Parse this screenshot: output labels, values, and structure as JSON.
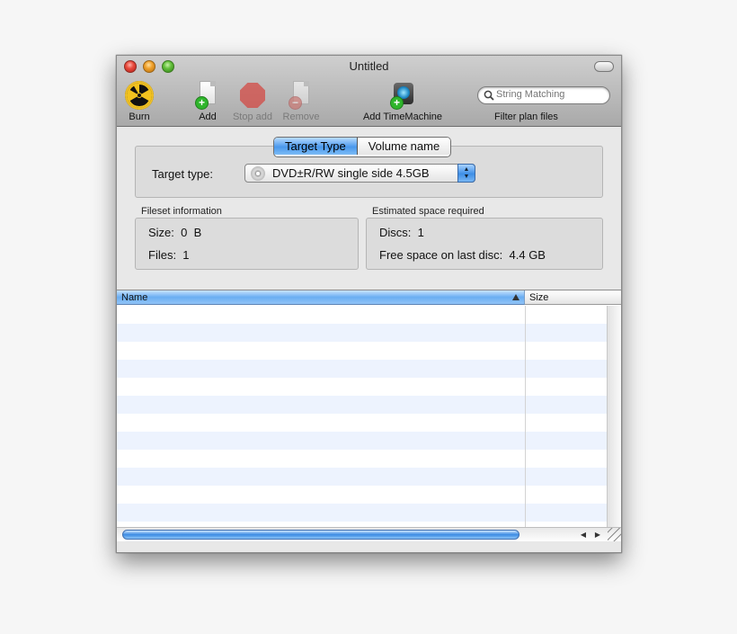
{
  "window": {
    "title": "Untitled"
  },
  "toolbar": {
    "burn_label": "Burn",
    "add_label": "Add",
    "stop_add_label": "Stop add",
    "remove_label": "Remove",
    "add_timemachine_label": "Add TimeMachine",
    "search_placeholder": "String Matching",
    "filter_label": "Filter plan files"
  },
  "tabs": {
    "active": "Target Type",
    "inactive": "Volume name"
  },
  "target": {
    "label": "Target type:",
    "selected": "DVD±R/RW single side 4.5GB"
  },
  "fileset": {
    "title": "Fileset information",
    "size_text": "Size:  0  B",
    "files_text": "Files:  1"
  },
  "estimated": {
    "title": "Estimated space required",
    "discs_text": "Discs:  1",
    "free_text": "Free space on last disc:  4.4 GB"
  },
  "table": {
    "columns": [
      "Name",
      "Size"
    ],
    "rows": []
  },
  "colors": {
    "accent": "#4a98ec",
    "stripe": "#edf3fe"
  }
}
